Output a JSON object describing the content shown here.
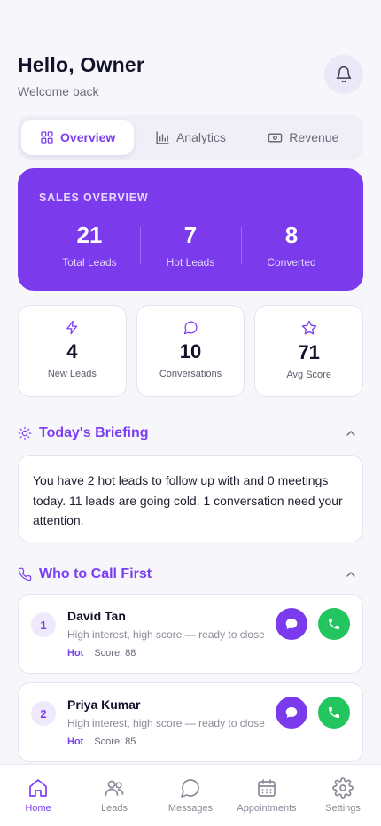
{
  "header": {
    "greeting": "Hello, Owner",
    "subtitle": "Welcome back"
  },
  "tabs": [
    {
      "label": "Overview",
      "icon": "grid-icon",
      "active": true
    },
    {
      "label": "Analytics",
      "icon": "bar-chart-icon",
      "active": false
    },
    {
      "label": "Revenue",
      "icon": "banknote-icon",
      "active": false
    }
  ],
  "sales_overview": {
    "title": "SALES OVERVIEW",
    "stats": [
      {
        "value": "21",
        "label": "Total Leads"
      },
      {
        "value": "7",
        "label": "Hot Leads"
      },
      {
        "value": "8",
        "label": "Converted"
      }
    ]
  },
  "mini_stats": [
    {
      "value": "4",
      "label": "New Leads",
      "icon": "lightning-icon"
    },
    {
      "value": "10",
      "label": "Conversations",
      "icon": "chat-bubble-icon"
    },
    {
      "value": "71",
      "label": "Avg Score",
      "icon": "star-icon"
    }
  ],
  "briefing": {
    "title": "Today's Briefing",
    "text": "You have 2 hot leads to follow up with and 0 meetings today. 11 leads are going cold. 1 conversation need your attention."
  },
  "call_first": {
    "title": "Who to Call First",
    "leads": [
      {
        "rank": "1",
        "name": "David Tan",
        "description": "High interest, high score — ready to close",
        "tag": "Hot",
        "score": "Score: 88"
      },
      {
        "rank": "2",
        "name": "Priya Kumar",
        "description": "High interest, high score — ready to close",
        "tag": "Hot",
        "score": "Score: 85"
      }
    ]
  },
  "nav": [
    {
      "label": "Home",
      "icon": "home-icon",
      "active": true
    },
    {
      "label": "Leads",
      "icon": "users-icon",
      "active": false
    },
    {
      "label": "Messages",
      "icon": "message-icon",
      "active": false
    },
    {
      "label": "Appointments",
      "icon": "calendar-icon",
      "active": false
    },
    {
      "label": "Settings",
      "icon": "gear-icon",
      "active": false
    }
  ],
  "colors": {
    "accent": "#7c3aed",
    "call": "#22c55e",
    "background": "#f7f6fb"
  }
}
